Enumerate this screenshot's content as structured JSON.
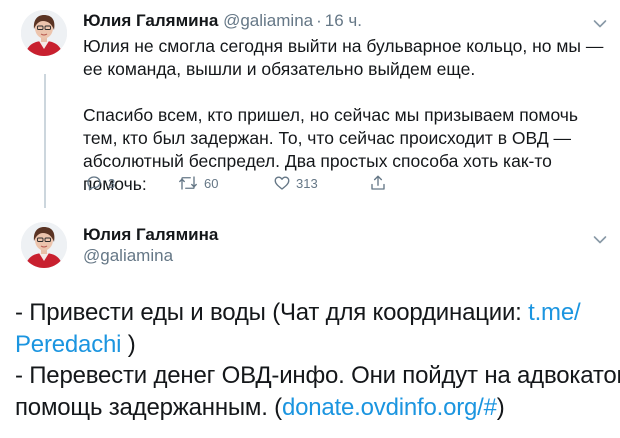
{
  "tweet1": {
    "author_name": "Юлия Галямина",
    "handle": "@galiamina",
    "separator": "·",
    "time": "16 ч.",
    "paragraphs": [
      "Юлия не смогла сегодня выйти на бульварное кольцо, но мы — ее команда, вышли и обязательно выйдем еще.",
      "Спасибо всем, кто пришел, но сейчас мы призываем помочь тем, кто был задержан. То, что сейчас происходит в ОВД — абсолютный беспредел. Два простых способа хоть как-то помочь:"
    ],
    "actions": {
      "reply_count": "3",
      "retweet_count": "60",
      "like_count": "313"
    }
  },
  "tweet2": {
    "author_name": "Юлия Галямина",
    "handle": "@galiamina",
    "lines": [
      {
        "prefix": "- Привести еды и воды (Чат для координации: ",
        "link": "t.me/",
        "suffix": ""
      },
      {
        "prefix": "",
        "link": "Peredachi",
        "suffix": " )"
      },
      {
        "prefix": "- Перевести денег ОВД-инфо. Они пойдут на адвокатов и",
        "link": "",
        "suffix": ""
      },
      {
        "prefix": "помощь задержанным. (",
        "link": "donate.ovdinfo.org/#",
        "suffix": ")"
      }
    ]
  },
  "icons": {
    "reply": "reply-icon",
    "retweet": "retweet-icon",
    "like": "heart-icon",
    "share": "share-icon",
    "menu": "chevron-down-icon"
  },
  "colors": {
    "text": "#14171a",
    "secondary": "#657786",
    "link": "#1b95e0",
    "thread_line": "#ccd6dd"
  }
}
